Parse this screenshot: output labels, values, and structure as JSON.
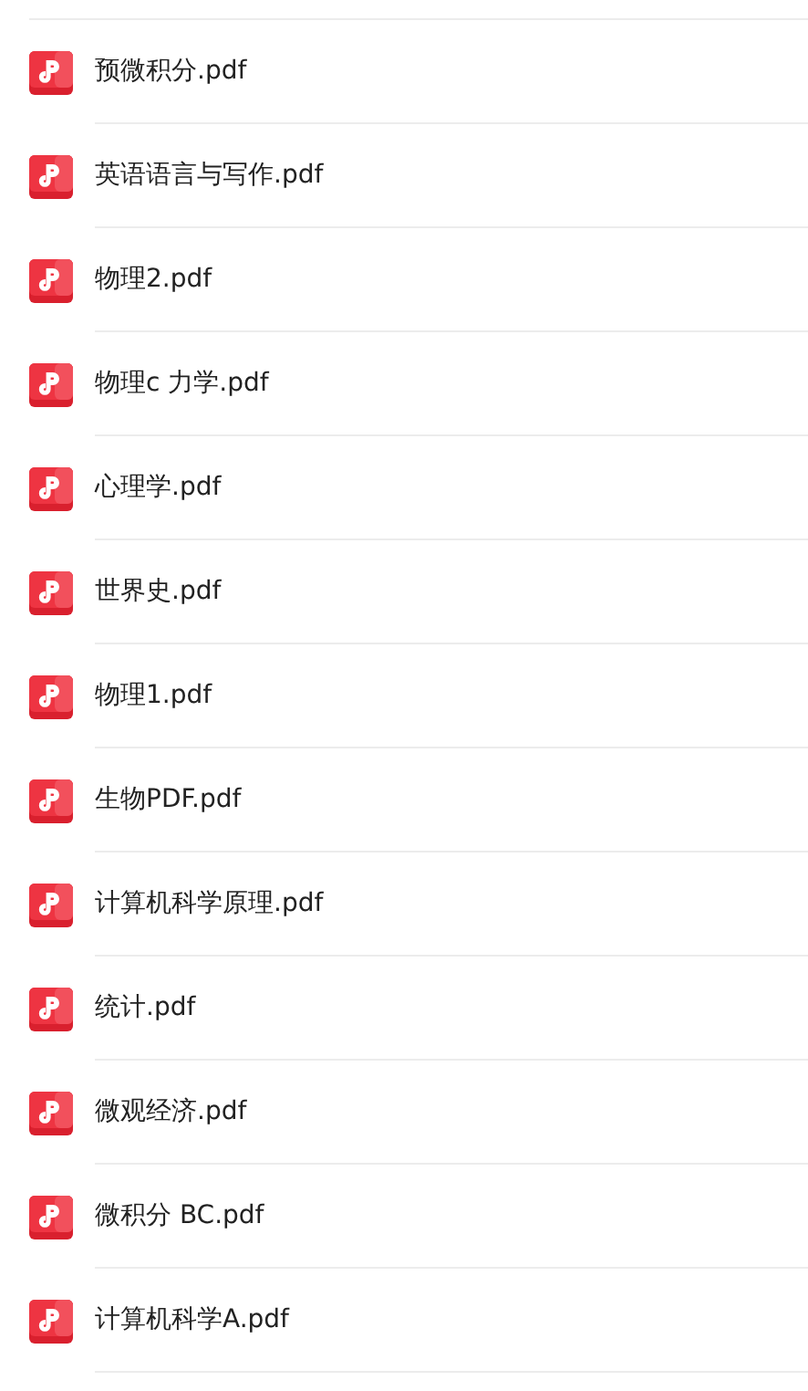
{
  "files": [
    {
      "name": "预微积分.pdf"
    },
    {
      "name": "英语语言与写作.pdf"
    },
    {
      "name": "物理2.pdf"
    },
    {
      "name": "物理c 力学.pdf"
    },
    {
      "name": "心理学.pdf"
    },
    {
      "name": "世界史.pdf"
    },
    {
      "name": "物理1.pdf"
    },
    {
      "name": "生物PDF.pdf"
    },
    {
      "name": "计算机科学原理.pdf"
    },
    {
      "name": "统计.pdf"
    },
    {
      "name": "微观经济.pdf"
    },
    {
      "name": "微积分 BC.pdf"
    },
    {
      "name": "计算机科学A.pdf"
    }
  ]
}
